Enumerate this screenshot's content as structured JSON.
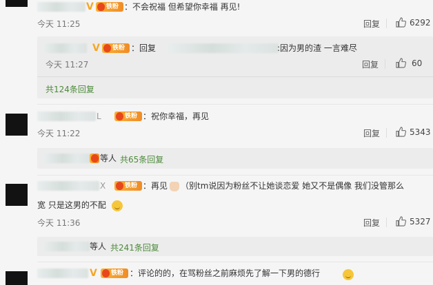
{
  "comments": [
    {
      "text": "：不会祝福 但希望你幸福 再见!",
      "time": "今天 11:25",
      "reply_label": "回复",
      "likes": "6292",
      "sub": {
        "prefix": "：回复",
        "text": ":因为男的渣 一言难尽",
        "time": "今天 11:27",
        "reply_label": "回复",
        "likes": "60"
      },
      "more": "共124条回复"
    },
    {
      "name_tail": "L",
      "text": "：祝你幸福，再见",
      "time": "今天 11:22",
      "reply_label": "回复",
      "likes": "5343",
      "more_prefix": "等人",
      "more": "共65条回复"
    },
    {
      "name_tail": "X",
      "text_a": "：再见",
      "text_b": " （别tm说因为粉丝不让她谈恋爱 她又不是偶像 我们没管那么",
      "text_line2": "宽 只是这男的不配",
      "time": "今天 11:36",
      "reply_label": "回复",
      "likes": "5327",
      "more_prefix": "等人",
      "more": "共241条回复"
    },
    {
      "text": "：评论的的，在骂粉丝之前麻烦先了解一下男的德行"
    }
  ],
  "badges": {
    "fan_label": "铁粉",
    "verified": "V"
  },
  "icons": {
    "like": "thumbs-up-icon",
    "emoji_smile": "smile-emoji-icon",
    "emoji_wave": "wave-hand-emoji-icon"
  },
  "colors": {
    "more_link": "#4c8a3a",
    "fan_badge": "#f5a623",
    "background": "#f5f5f5"
  }
}
